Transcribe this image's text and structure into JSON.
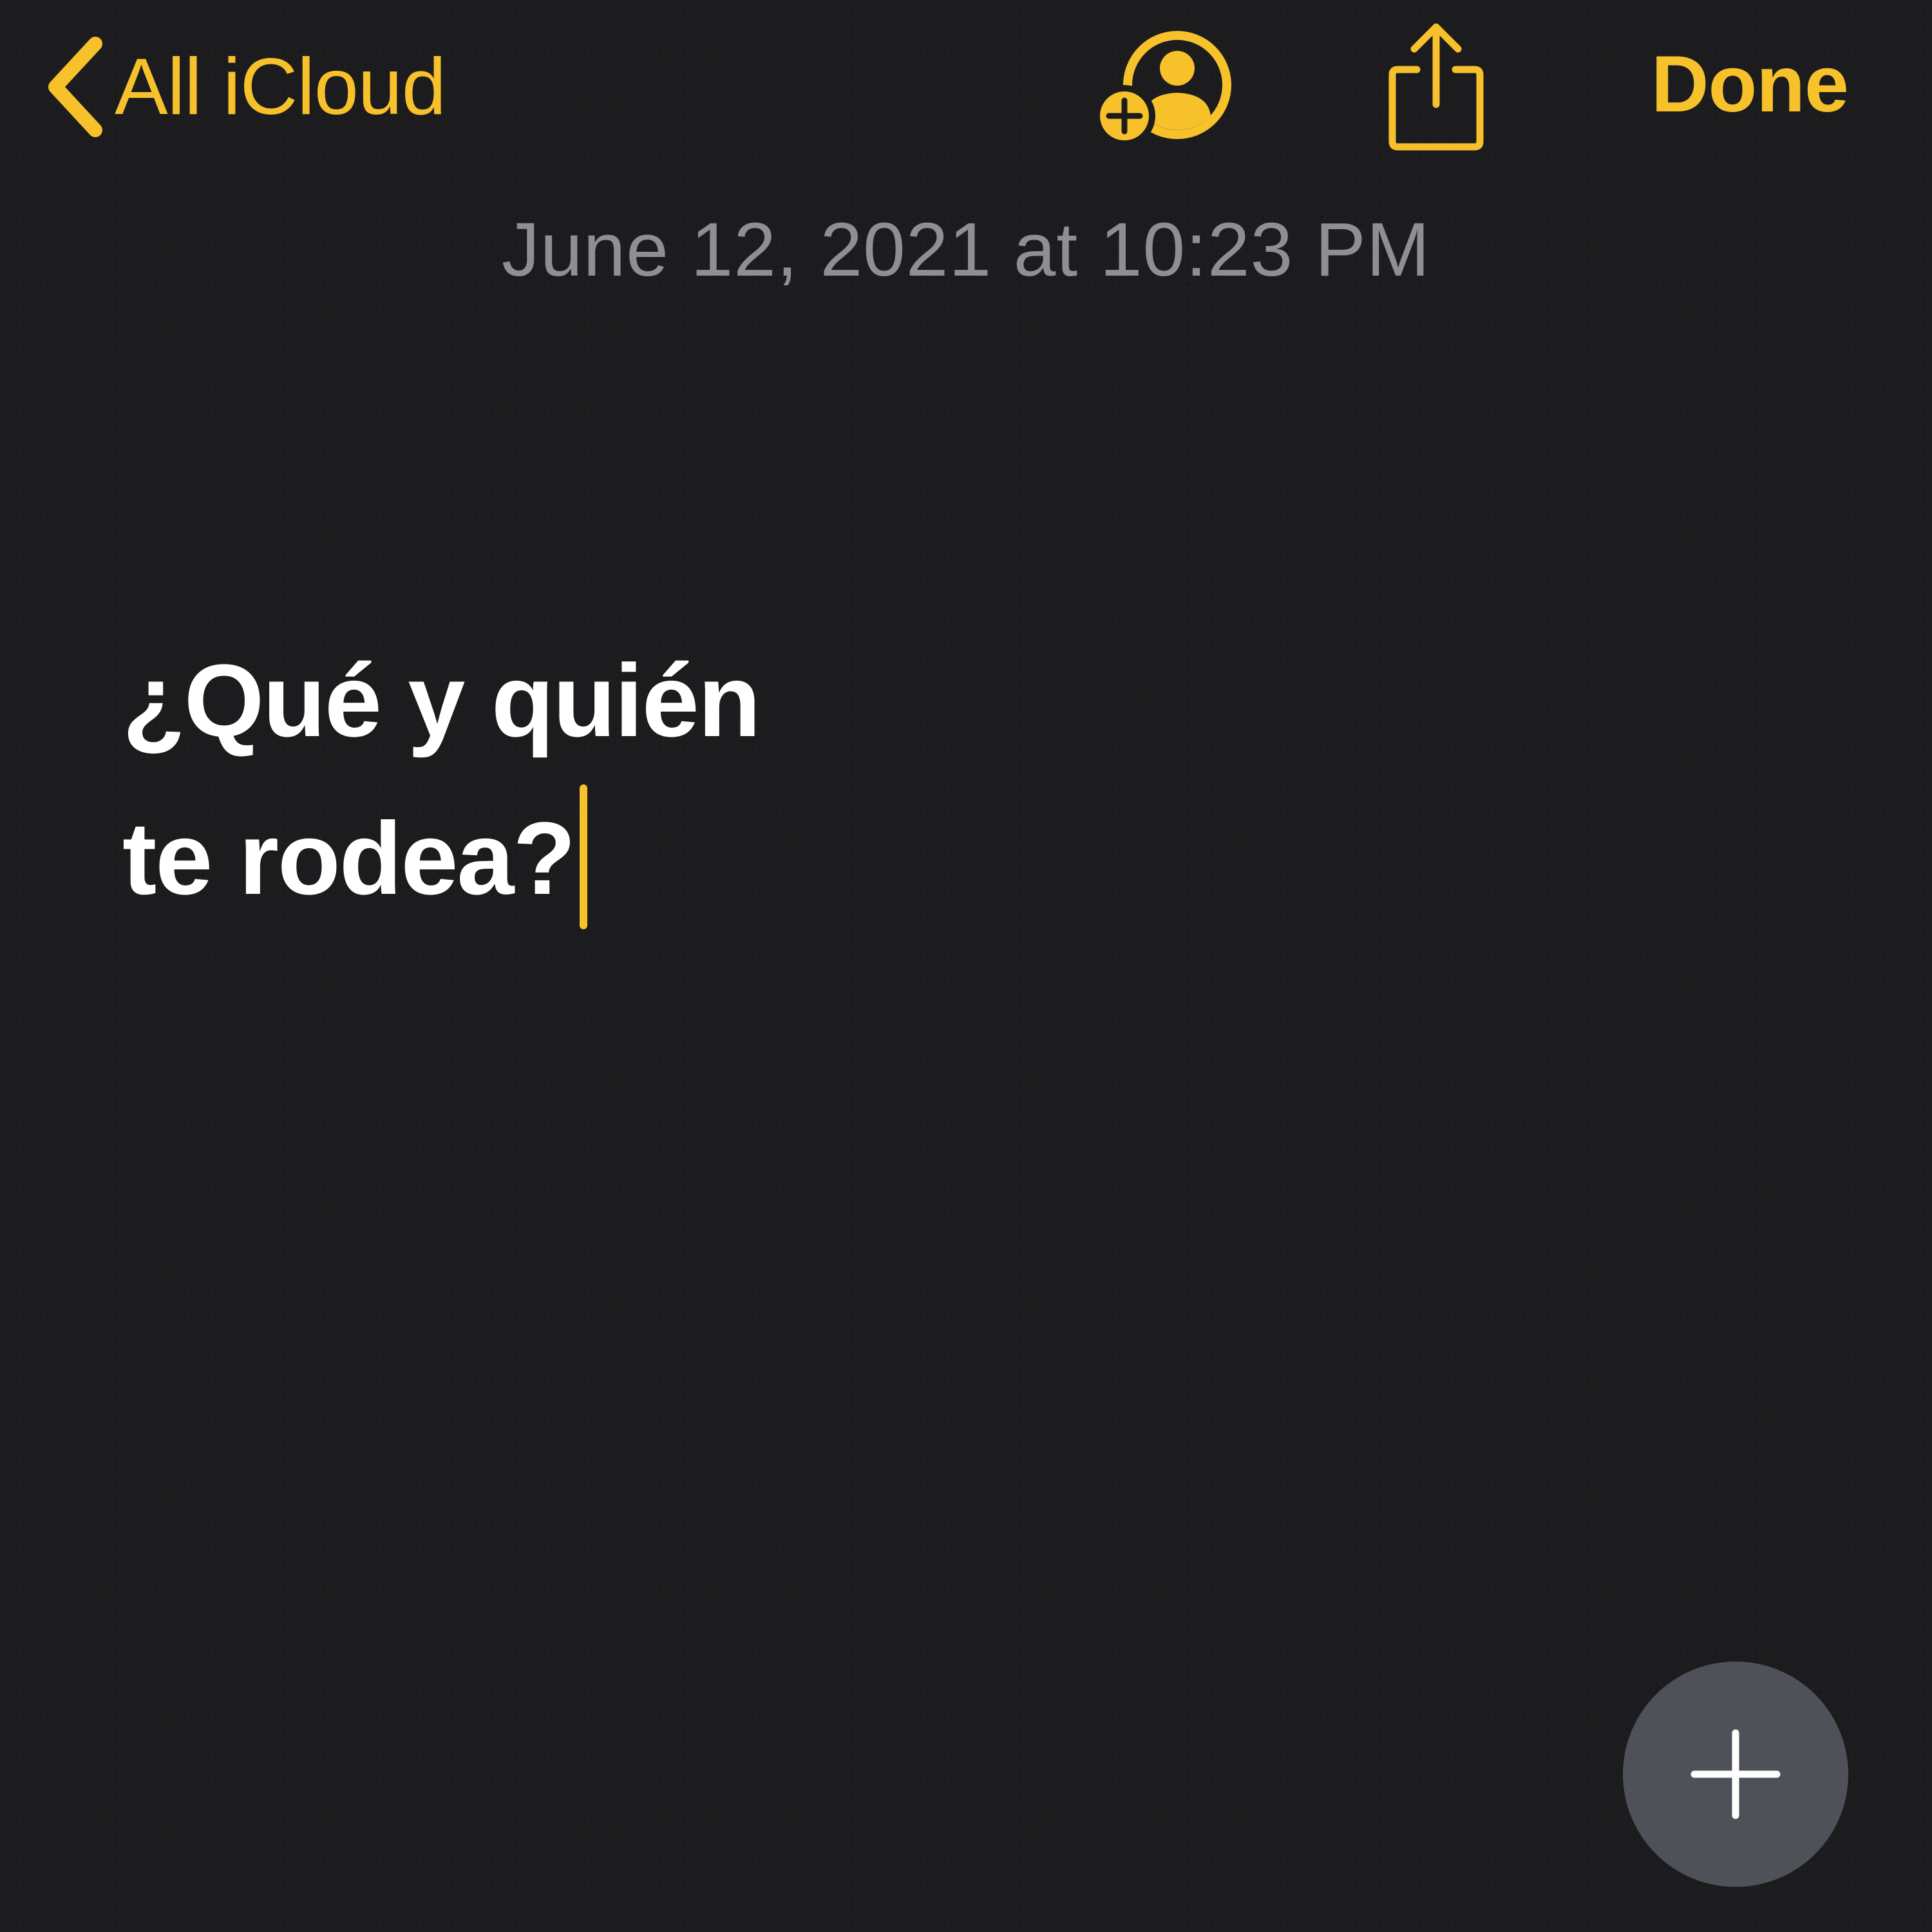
{
  "nav": {
    "back_label": "All iCloud",
    "back_icon": "chevron-left-icon",
    "add_person_icon": "person-add-icon",
    "share_icon": "share-icon",
    "done_label": "Done"
  },
  "note": {
    "timestamp": "June 12, 2021 at 10:23 PM",
    "lines": [
      "¿Qué y quién",
      "te rodea?"
    ]
  },
  "fab": {
    "icon": "plus-icon"
  },
  "colors": {
    "accent": "#f7c12b",
    "background": "#1c1c1e",
    "text": "#ffffff",
    "timestamp": "#8e8e93",
    "fab_background": "#4e5157"
  }
}
